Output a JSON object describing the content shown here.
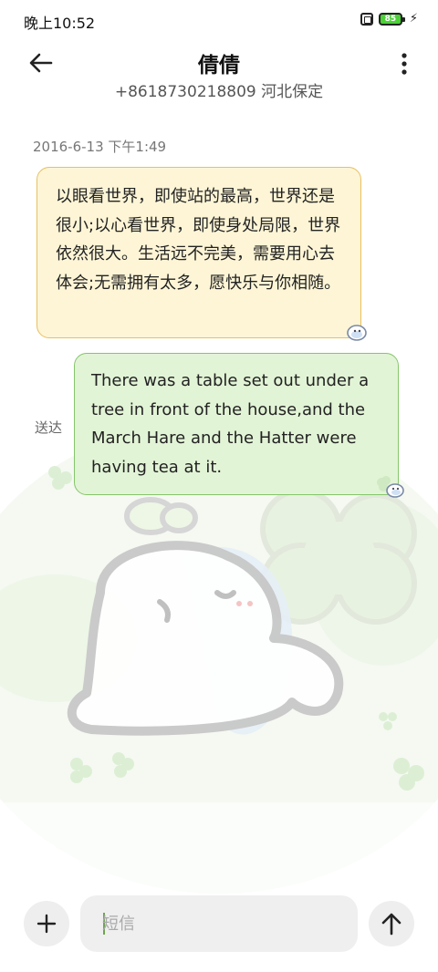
{
  "status_bar": {
    "time": "晚上10:52",
    "battery_level": "85",
    "charging_icon": "bolt-icon",
    "sim_icon": "sim-icon"
  },
  "header": {
    "contact_name": "倩倩",
    "contact_detail": "+8618730218809 河北保定",
    "back_icon": "arrow-left-icon",
    "menu_icon": "more-vertical-icon"
  },
  "conversation": {
    "timestamp": "2016-6-13 下午1:49",
    "messages": [
      {
        "direction": "incoming",
        "text": "以眼看世界，即使站的最高，世界还是很小;以心看世界，即使身处局限，世界依然很大。生活远不完美，需要用心去体会;无需拥有太多，愿快乐与你相随。"
      },
      {
        "direction": "outgoing",
        "status": "送达",
        "text": "There was a table set out under a tree in front of the house,and the March Hare and the Hatter were having tea at it."
      }
    ]
  },
  "composer": {
    "placeholder": "短信",
    "add_icon": "plus-icon",
    "send_icon": "arrow-up-icon"
  },
  "colors": {
    "incoming_bubble_bg": "#fdf5d6",
    "incoming_bubble_border": "#e8c060",
    "outgoing_bubble_bg": "#e2f4d6",
    "outgoing_bubble_border": "#85c66a",
    "battery_green": "#4cd137"
  }
}
